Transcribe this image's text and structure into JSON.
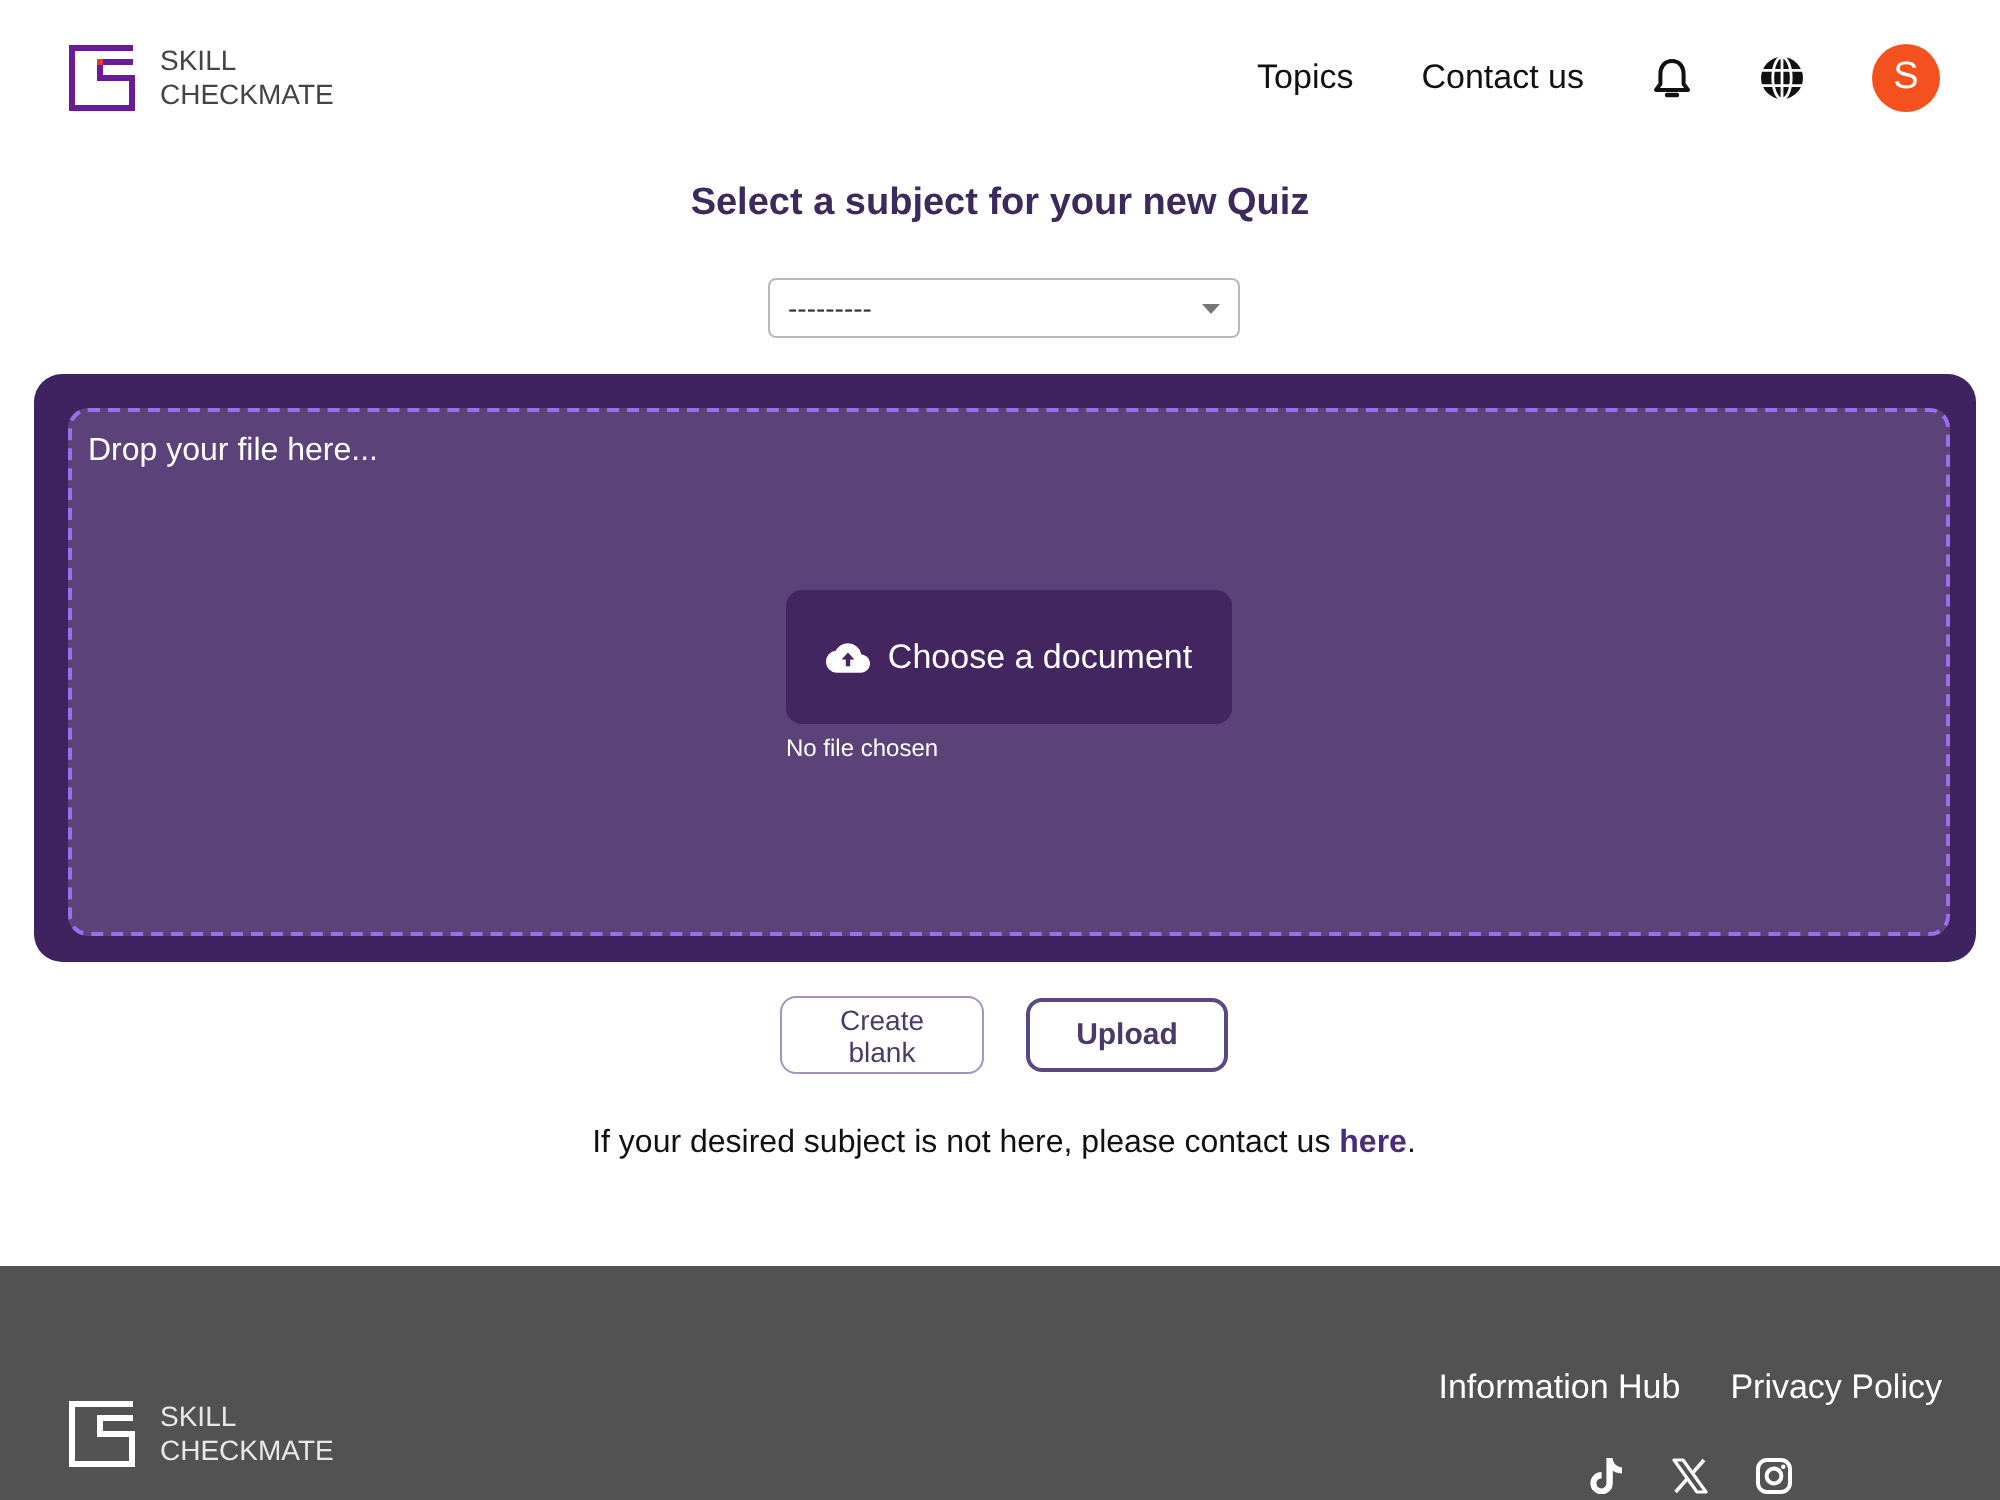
{
  "header": {
    "brand": "SKILL CHECKMATE",
    "nav": [
      "Topics",
      "Contact us"
    ],
    "avatar": {
      "initial": "S"
    }
  },
  "subject": {
    "title": "Select a subject for your new Quiz",
    "select": {
      "value": "---------"
    }
  },
  "dropzone": {
    "hint": "Drop your file here...",
    "choose_button": "Choose a document",
    "file_status": "No file chosen"
  },
  "actions": {
    "buttons": [
      {
        "label": "Create blank",
        "kind": "secondary"
      },
      {
        "label": "Upload",
        "kind": "primary"
      }
    ],
    "note": {
      "text": "If your desired subject is not here, please contact us ",
      "link": "here",
      "end": "."
    }
  },
  "footer": {
    "brand": "SKILL CHECKMATE",
    "links": [
      "Information Hub",
      "Privacy Policy"
    ]
  }
}
